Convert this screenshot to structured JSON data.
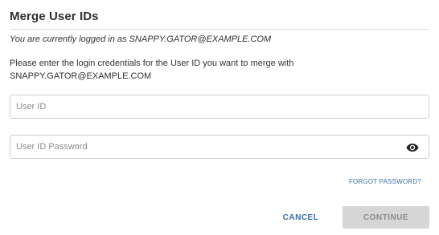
{
  "dialog": {
    "title": "Merge User IDs",
    "logged_in_text": "You are currently logged in as SNAPPY.GATOR@EXAMPLE.COM",
    "instructions_line1": "Please enter the login credentials for the User ID you want to merge with",
    "instructions_line2": "SNAPPY.GATOR@EXAMPLE.COM"
  },
  "form": {
    "user_id": {
      "placeholder": "User ID",
      "value": ""
    },
    "password": {
      "placeholder": "User ID Password",
      "value": "",
      "toggle_icon": "eye-icon"
    },
    "forgot_password_label": "FORGOT PASSWORD?"
  },
  "actions": {
    "cancel_label": "CANCEL",
    "continue_label": "CONTINUE",
    "continue_disabled": true
  },
  "colors": {
    "link": "#3a6ea5",
    "disabled_button_bg": "#d6d6d6",
    "disabled_button_text": "#8c8c8c",
    "border": "#d0d0d0"
  }
}
